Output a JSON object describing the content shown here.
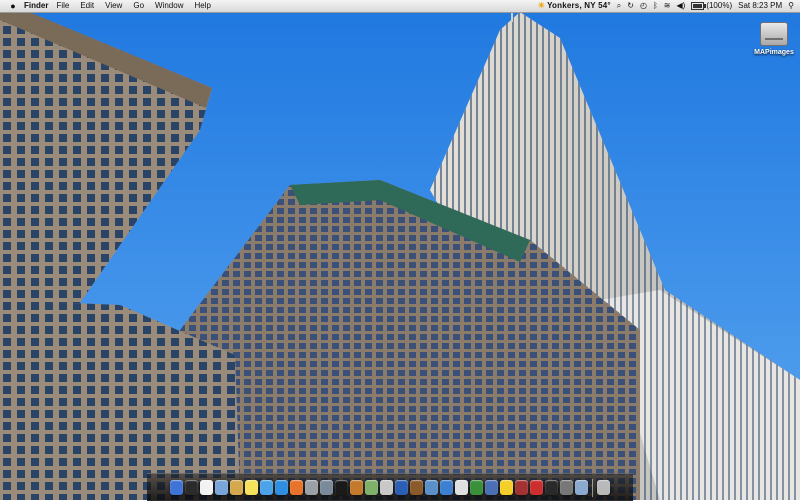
{
  "menubar": {
    "apple_icon": "apple-icon",
    "app_name": "Finder",
    "menus": [
      "File",
      "Edit",
      "View",
      "Go",
      "Window",
      "Help"
    ],
    "weather": "Yonkers, NY 54°",
    "battery_percent": "(100%)",
    "clock": "Sat 8:23 PM",
    "status_icons": [
      "paperclip-icon",
      "sync-icon",
      "time-machine-icon",
      "bluetooth-icon",
      "wifi-icon",
      "volume-icon",
      "battery-icon",
      "search-icon"
    ]
  },
  "desktop": {
    "drive_label": "MAPimages",
    "drive_icon": "hard-drive-icon"
  },
  "dock": {
    "items": [
      {
        "name": "finder-icon",
        "color": "#3f74d6"
      },
      {
        "name": "dashboard-icon",
        "color": "#2b2b2b"
      },
      {
        "name": "calendar-icon",
        "color": "#f2f2f2"
      },
      {
        "name": "preview-icon",
        "color": "#7aa5d8"
      },
      {
        "name": "notes-icon",
        "color": "#d4a84c"
      },
      {
        "name": "stickies-icon",
        "color": "#f6e25a"
      },
      {
        "name": "ichat-icon",
        "color": "#4ca3e8"
      },
      {
        "name": "safari-icon",
        "color": "#2f8ee0"
      },
      {
        "name": "firefox-icon",
        "color": "#e8742c"
      },
      {
        "name": "system-preferences-icon",
        "color": "#9aa0a6"
      },
      {
        "name": "iphoto-icon",
        "color": "#7b8a9a"
      },
      {
        "name": "music-icon",
        "color": "#1a1a1a"
      },
      {
        "name": "garageband-icon",
        "color": "#c47a2c"
      },
      {
        "name": "maps-icon",
        "color": "#7fb069"
      },
      {
        "name": "compass-icon",
        "color": "#c8c8c8"
      },
      {
        "name": "word-icon",
        "color": "#2b5fb3"
      },
      {
        "name": "script-icon",
        "color": "#8b5a2b"
      },
      {
        "name": "utility-icon",
        "color": "#5a8fc7"
      },
      {
        "name": "network-icon",
        "color": "#3d7fd1"
      },
      {
        "name": "font-icon",
        "color": "#e0e0e0"
      },
      {
        "name": "app-store-icon",
        "color": "#3a8f3a"
      },
      {
        "name": "xcode-icon",
        "color": "#4a6fb5"
      },
      {
        "name": "duck-icon",
        "color": "#f4cf2a"
      },
      {
        "name": "photo-booth-icon",
        "color": "#a33232"
      },
      {
        "name": "flash-icon",
        "color": "#cc2f2f"
      },
      {
        "name": "terminal-icon",
        "color": "#2a2a2a"
      },
      {
        "name": "monitor-icon",
        "color": "#777777"
      },
      {
        "name": "folder-icon",
        "color": "#8aa9cf"
      }
    ],
    "trash": {
      "name": "trash-icon",
      "color": "#b9b9b9"
    }
  }
}
